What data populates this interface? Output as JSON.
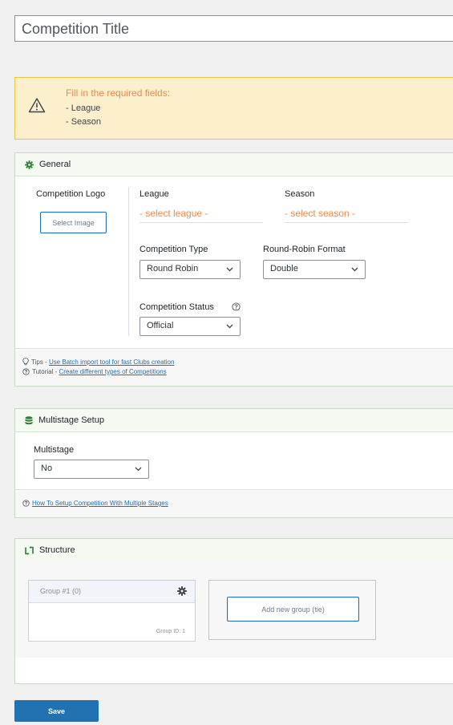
{
  "title_input": {
    "placeholder": "Competition Title"
  },
  "notice": {
    "title": "Fill in the required fields:",
    "items": [
      "- League",
      "- Season"
    ]
  },
  "general": {
    "heading": "General",
    "logo": {
      "label": "Competition Logo",
      "button": "Select Image"
    },
    "league": {
      "label": "League",
      "value": "- select league -"
    },
    "season": {
      "label": "Season",
      "value": "- select season -"
    },
    "competition_type": {
      "label": "Competition Type",
      "value": "Round Robin"
    },
    "rr_format": {
      "label": "Round-Robin Format",
      "value": "Double"
    },
    "status": {
      "label": "Competition Status",
      "value": "Official"
    },
    "tips": {
      "prefix": "Tips - ",
      "link": "Use Batch import tool for fast Clubs creation"
    },
    "tutorial": {
      "prefix": "Tutorial - ",
      "link": "Create different types of Competitions"
    }
  },
  "multistage": {
    "heading": "Multistage Setup",
    "label": "Multistage",
    "value": "No",
    "help_link": "How To Setup Competition With Multiple Stages"
  },
  "structure": {
    "heading": "Structure",
    "group": {
      "title": "Group #1 (0)",
      "id_text": "Group ID: 1"
    },
    "add_button": "Add new group (tie)"
  },
  "save_button": "Save",
  "colors": {
    "accent": "#2271b1",
    "warning": "#e78a4f",
    "panel_border": "#c3dcbf",
    "icon_green": "#2e7d32"
  }
}
